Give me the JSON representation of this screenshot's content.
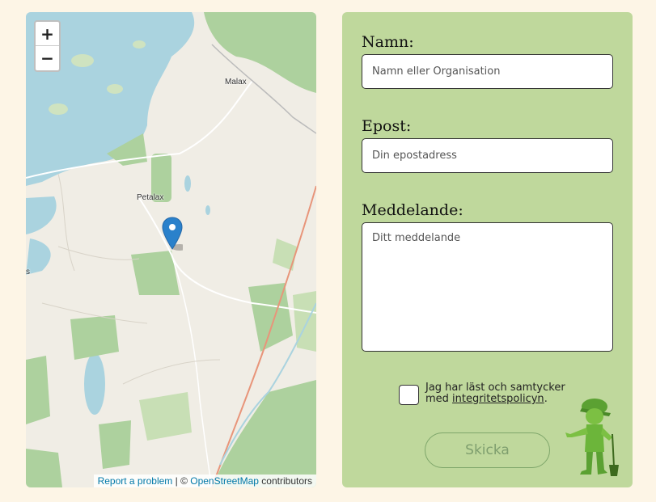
{
  "map": {
    "zoom_in": "+",
    "zoom_out": "−",
    "places": [
      "Malax",
      "Petalax",
      "s"
    ],
    "attribution": {
      "report": "Report a problem",
      "sep": " | © ",
      "osm": "OpenStreetMap",
      "contributors": " contributors"
    }
  },
  "form": {
    "name_label": "Namn:",
    "name_placeholder": "Namn eller Organisation",
    "email_label": "Epost:",
    "email_placeholder": "Din epostadress",
    "message_label": "Meddelande:",
    "message_placeholder": "Ditt meddelande",
    "consent_text": "Jag har läst och samtycker med ",
    "consent_link": "integritetspolicyn",
    "consent_end": ".",
    "submit": "Skicka"
  },
  "colors": {
    "page_bg": "#fdf5e6",
    "form_bg": "#bfd89c",
    "water": "#aad3df",
    "forest": "#add19e",
    "marker": "#2a81cb"
  },
  "icons": [
    "map-marker-icon",
    "gardener-mascot-icon"
  ]
}
